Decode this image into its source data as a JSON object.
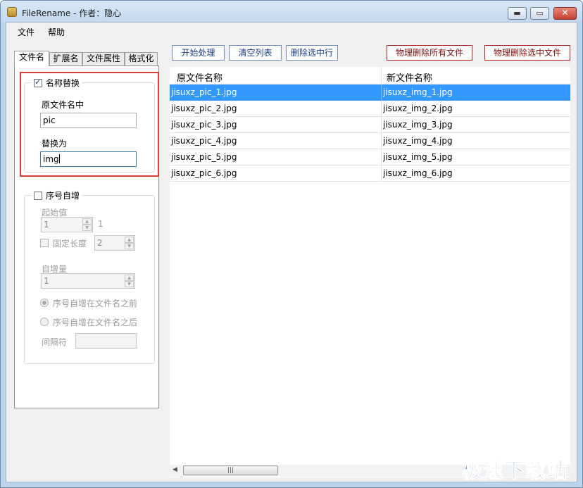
{
  "window": {
    "title": "FileRename - 作者：隐心",
    "min_glyph": "▬",
    "max_glyph": "▭",
    "close_glyph": "✕"
  },
  "menu": [
    {
      "label": "文件"
    },
    {
      "label": "帮助"
    }
  ],
  "tabs": [
    {
      "label": "文件名"
    },
    {
      "label": "扩展名"
    },
    {
      "label": "文件属性"
    },
    {
      "label": "格式化"
    }
  ],
  "name_replace": {
    "title": "名称替换",
    "checked": true,
    "find_label": "原文件名中",
    "find_value": "pic",
    "replace_label": "替换为",
    "replace_value": "img"
  },
  "sequence": {
    "title": "序号自增",
    "start_label": "起始值",
    "start_value": "1",
    "start_preview": "1",
    "fixed_length_label": "固定长度",
    "fixed_length_value": "2",
    "increment_label": "自增量",
    "increment_value": "1",
    "before_label": "序号自增在文件名之前",
    "after_label": "序号自增在文件名之后",
    "separator_label": "间隔符",
    "separator_value": ""
  },
  "toolbar": {
    "start": "开始处理",
    "clear": "清空列表",
    "delete_selected_row": "删除选中行",
    "physical_delete_all": "物理删除所有文件",
    "physical_delete_selected": "物理删除选中文件"
  },
  "list": {
    "columns": [
      "原文件名称",
      "新文件名称"
    ],
    "rows": [
      {
        "original": "jisuxz_pic_1.jpg",
        "new": "jisuxz_img_1.jpg"
      },
      {
        "original": "jisuxz_pic_2.jpg",
        "new": "jisuxz_img_2.jpg"
      },
      {
        "original": "jisuxz_pic_3.jpg",
        "new": "jisuxz_img_3.jpg"
      },
      {
        "original": "jisuxz_pic_4.jpg",
        "new": "jisuxz_img_4.jpg"
      },
      {
        "original": "jisuxz_pic_5.jpg",
        "new": "jisuxz_img_5.jpg"
      },
      {
        "original": "jisuxz_pic_6.jpg",
        "new": "jisuxz_img_6.jpg"
      }
    ],
    "selected_row": 0
  },
  "scrollbar": {
    "left_arrow": "◀",
    "grip": "|||"
  },
  "watermark": "极速下载站",
  "colors": {
    "selection": "#3399ff",
    "highlight_border": "#d83f3b",
    "danger_text": "#7c0f0f"
  }
}
